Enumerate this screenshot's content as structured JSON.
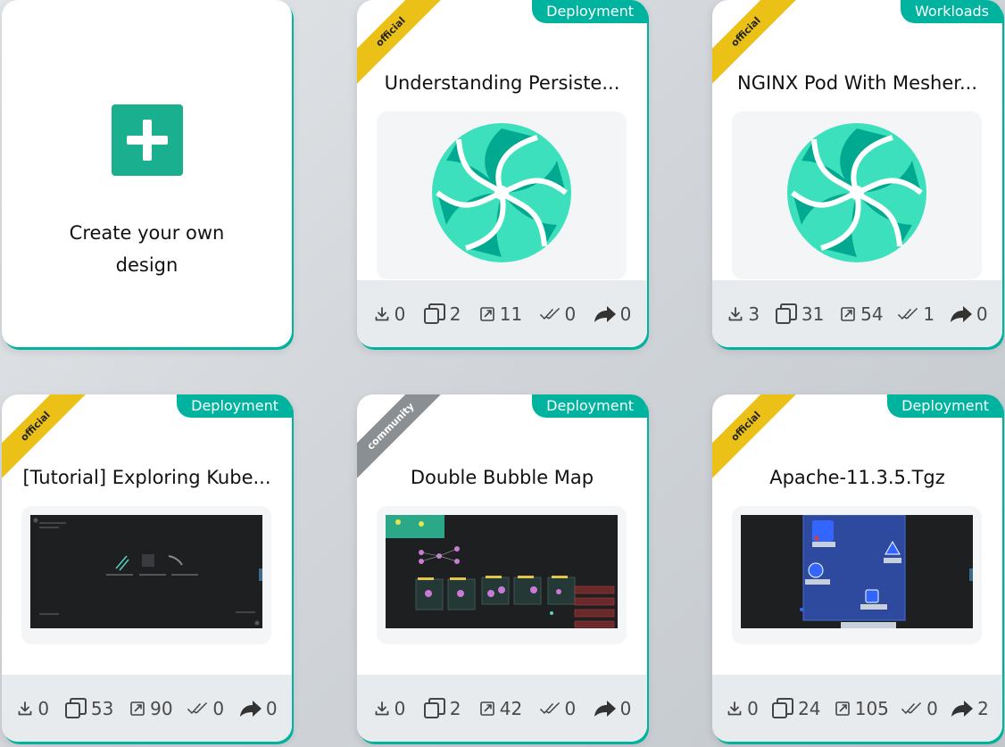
{
  "create_card": {
    "text": "Create your own design",
    "icon": "plus-icon"
  },
  "cards": [
    {
      "title": "Understanding Persiste...",
      "type": "Deployment",
      "badge": "official",
      "thumb": "meshery-logo",
      "stats": {
        "downloads": "0",
        "clones": "2",
        "opens": "11",
        "deploys": "0",
        "shares": "0"
      }
    },
    {
      "title": "NGINX Pod With Mesher...",
      "type": "Workloads",
      "badge": "official",
      "thumb": "meshery-logo",
      "stats": {
        "downloads": "3",
        "clones": "31",
        "opens": "54",
        "deploys": "1",
        "shares": "0"
      }
    },
    {
      "title": "[Tutorial] Exploring Kube...",
      "type": "Deployment",
      "badge": "official",
      "thumb": "design-screenshot",
      "stats": {
        "downloads": "0",
        "clones": "53",
        "opens": "90",
        "deploys": "0",
        "shares": "0"
      }
    },
    {
      "title": "Double Bubble Map",
      "type": "Deployment",
      "badge": "community",
      "thumb": "design-screenshot",
      "stats": {
        "downloads": "0",
        "clones": "2",
        "opens": "42",
        "deploys": "0",
        "shares": "0"
      }
    },
    {
      "title": "Apache-11.3.5.Tgz",
      "type": "Deployment",
      "badge": "official",
      "thumb": "design-screenshot",
      "stats": {
        "downloads": "0",
        "clones": "24",
        "opens": "105",
        "deploys": "0",
        "shares": "2"
      }
    }
  ],
  "colors": {
    "accent": "#00b39f",
    "official": "#ebc017",
    "community": "#8a8f94"
  }
}
